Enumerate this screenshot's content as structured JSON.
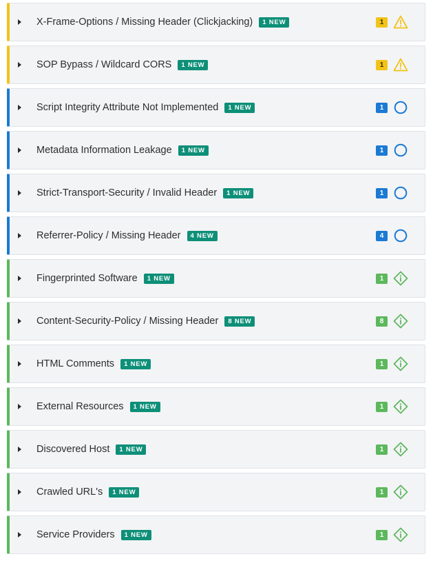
{
  "colors": {
    "high": "#f2c318",
    "medium": "#1a7ad4",
    "low": "#5cb85c",
    "new_badge": "#0e8f78"
  },
  "findings": [
    {
      "title": "X-Frame-Options / Missing Header (Clickjacking)",
      "new_label": "1 NEW",
      "count": "1",
      "severity": "high",
      "icon": "warning-triangle-icon"
    },
    {
      "title": "SOP Bypass / Wildcard CORS",
      "new_label": "1 NEW",
      "count": "1",
      "severity": "high",
      "icon": "warning-triangle-icon"
    },
    {
      "title": "Script Integrity Attribute Not Implemented",
      "new_label": "1 NEW",
      "count": "1",
      "severity": "medium",
      "icon": "circle-icon"
    },
    {
      "title": "Metadata Information Leakage",
      "new_label": "1 NEW",
      "count": "1",
      "severity": "medium",
      "icon": "circle-icon"
    },
    {
      "title": "Strict-Transport-Security / Invalid Header",
      "new_label": "1 NEW",
      "count": "1",
      "severity": "medium",
      "icon": "circle-icon"
    },
    {
      "title": "Referrer-Policy / Missing Header",
      "new_label": "4 NEW",
      "count": "4",
      "severity": "medium",
      "icon": "circle-icon"
    },
    {
      "title": "Fingerprinted Software",
      "new_label": "1 NEW",
      "count": "1",
      "severity": "low",
      "icon": "info-diamond-icon"
    },
    {
      "title": "Content-Security-Policy / Missing Header",
      "new_label": "8 NEW",
      "count": "8",
      "severity": "low",
      "icon": "info-diamond-icon"
    },
    {
      "title": "HTML Comments",
      "new_label": "1 NEW",
      "count": "1",
      "severity": "low",
      "icon": "info-diamond-icon"
    },
    {
      "title": "External Resources",
      "new_label": "1 NEW",
      "count": "1",
      "severity": "low",
      "icon": "info-diamond-icon"
    },
    {
      "title": "Discovered Host",
      "new_label": "1 NEW",
      "count": "1",
      "severity": "low",
      "icon": "info-diamond-icon"
    },
    {
      "title": "Crawled URL's",
      "new_label": "1 NEW",
      "count": "1",
      "severity": "low",
      "icon": "info-diamond-icon"
    },
    {
      "title": "Service Providers",
      "new_label": "1 NEW",
      "count": "1",
      "severity": "low",
      "icon": "info-diamond-icon"
    }
  ]
}
